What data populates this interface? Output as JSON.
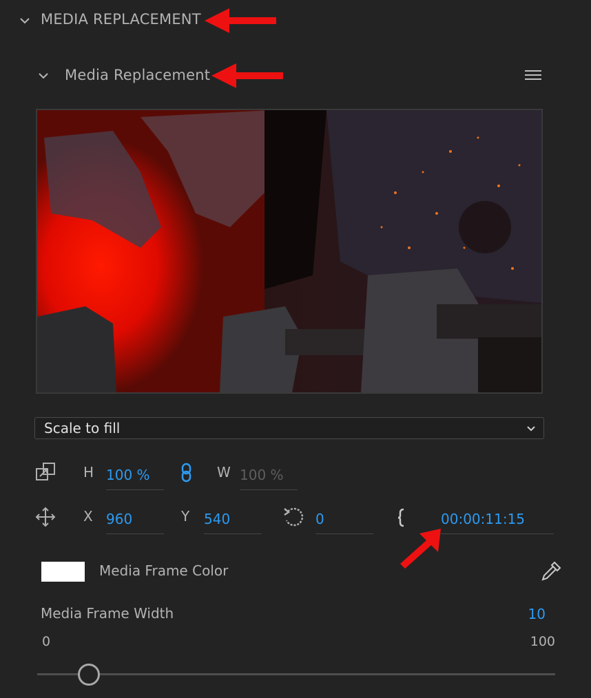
{
  "section": {
    "title": "MEDIA REPLACEMENT",
    "subtitle": "Media Replacement"
  },
  "scale_dropdown": {
    "selected": "Scale to fill"
  },
  "size": {
    "h_label": "H",
    "h_value": "100 %",
    "w_label": "W",
    "w_value": "100 %"
  },
  "position": {
    "x_label": "X",
    "x_value": "960",
    "y_label": "Y",
    "y_value": "540",
    "rotation_value": "0",
    "timecode": "00:00:11:15"
  },
  "frame_color": {
    "label": "Media Frame Color",
    "color": "#ffffff"
  },
  "frame_width": {
    "label": "Media Frame Width",
    "value": "10",
    "min": "0",
    "max": "100",
    "level": 0.1
  },
  "colors": {
    "background": "#232323",
    "accent": "#2d9af0",
    "annotation_arrow": "#ee1111"
  },
  "icons": [
    "chevron-down-icon",
    "hamburger-menu-icon",
    "scale-icon",
    "link-icon",
    "move-icon",
    "rotate-icon",
    "bracket-icon",
    "eyedropper-icon"
  ]
}
